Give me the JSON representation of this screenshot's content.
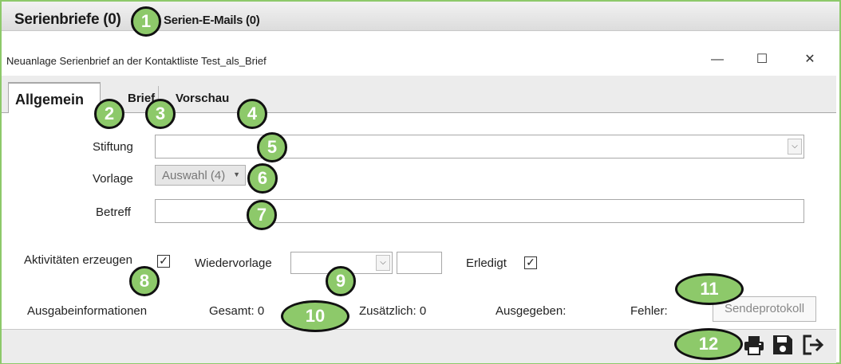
{
  "top_tabs": {
    "serienbriefe": "Serienbriefe (0)",
    "serien_emails": "Serien-E-Mails (0)"
  },
  "window": {
    "title": "Neuanlage Serienbrief an der Kontaktliste Test_als_Brief",
    "minimize": "—",
    "maximize": "☐",
    "close": "✕"
  },
  "tabs": [
    "Allgemein",
    "Brief",
    "Vorschau"
  ],
  "form": {
    "stiftung_label": "Stiftung",
    "stiftung_value": "",
    "vorlage_label": "Vorlage",
    "vorlage_value": "Auswahl (4)",
    "betreff_label": "Betreff",
    "betreff_value": "",
    "aktivitaeten_label": "Aktivitäten erzeugen",
    "aktivitaeten_checked": true,
    "wiedervorlage_label": "Wiedervorlage",
    "wiedervorlage_value": "",
    "erledigt_label": "Erledigt",
    "erledigt_checked": true
  },
  "ausgabe": {
    "title": "Ausgabeinformationen",
    "gesamt": "Gesamt: 0",
    "zusaetzlich": "Zusätzlich: 0",
    "ausgegeben": "Ausgegeben:",
    "fehler": "Fehler:",
    "sendeprotokoll": "Sendeprotokoll"
  },
  "toolbar_icons": [
    "print-icon",
    "save-icon",
    "exit-icon"
  ],
  "badges": [
    "1",
    "2",
    "3",
    "4",
    "5",
    "6",
    "7",
    "8",
    "9",
    "10",
    "11",
    "12"
  ],
  "colors": {
    "badge_fill": "#8dc96a",
    "badge_border": "#111111",
    "frame_border": "#8dc96a"
  }
}
